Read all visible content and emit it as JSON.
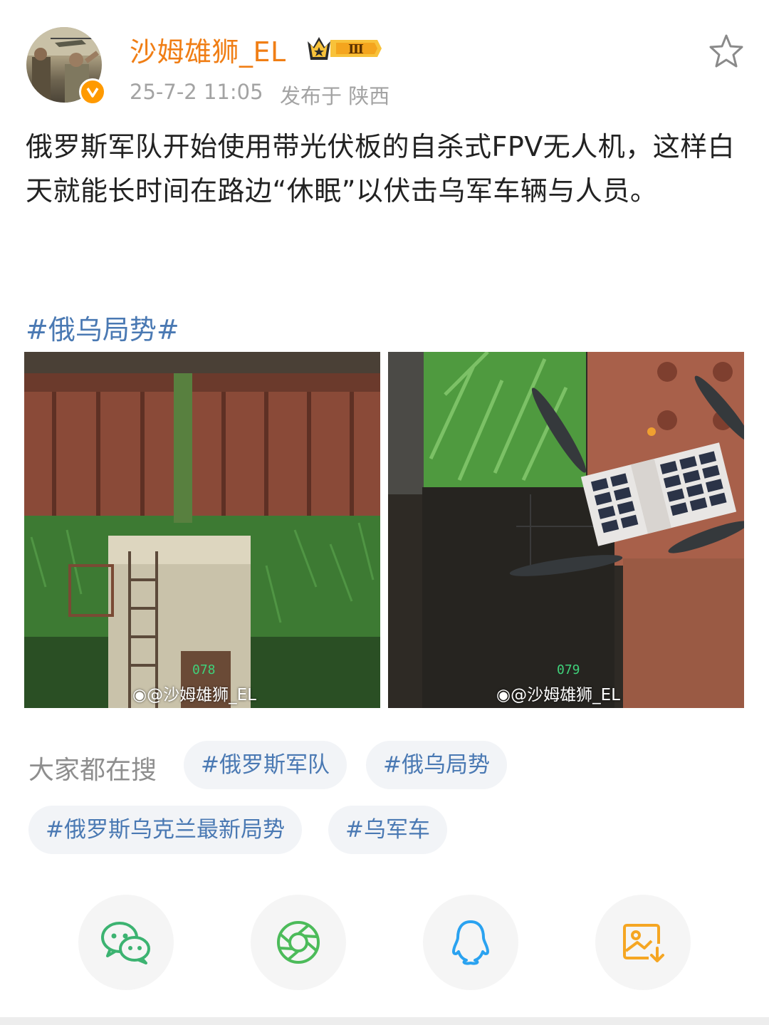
{
  "header": {
    "username": "沙姆雄狮_EL",
    "level_badge": "Ⅲ",
    "time": "25-7-2 11:05",
    "location": "发布于  陕西"
  },
  "post": {
    "text": "俄罗斯军队开始使用带光伏板的自杀式FPV无人机，这样白天就能长时间在路边“休眠”以伏击乌军车辆与人员。",
    "hashtag": "#俄乌局势#"
  },
  "images": [
    {
      "watermark": "@沙姆雄狮_EL",
      "frame": "078"
    },
    {
      "watermark": "@沙姆雄狮_EL",
      "frame": "079"
    }
  ],
  "trending": {
    "label": "大家都在搜",
    "tags": [
      "#俄罗斯军队",
      "#俄乌局势",
      "#俄罗斯乌克兰最新局势",
      "#乌军车"
    ]
  },
  "share": {
    "icons": [
      "wechat-icon",
      "moments-icon",
      "qq-icon",
      "save-image-icon"
    ]
  },
  "colors": {
    "username": "#f07e15",
    "link": "#4a79b3",
    "wechat": "#3cb371",
    "qq": "#2aa2f0",
    "save": "#f5a623"
  }
}
